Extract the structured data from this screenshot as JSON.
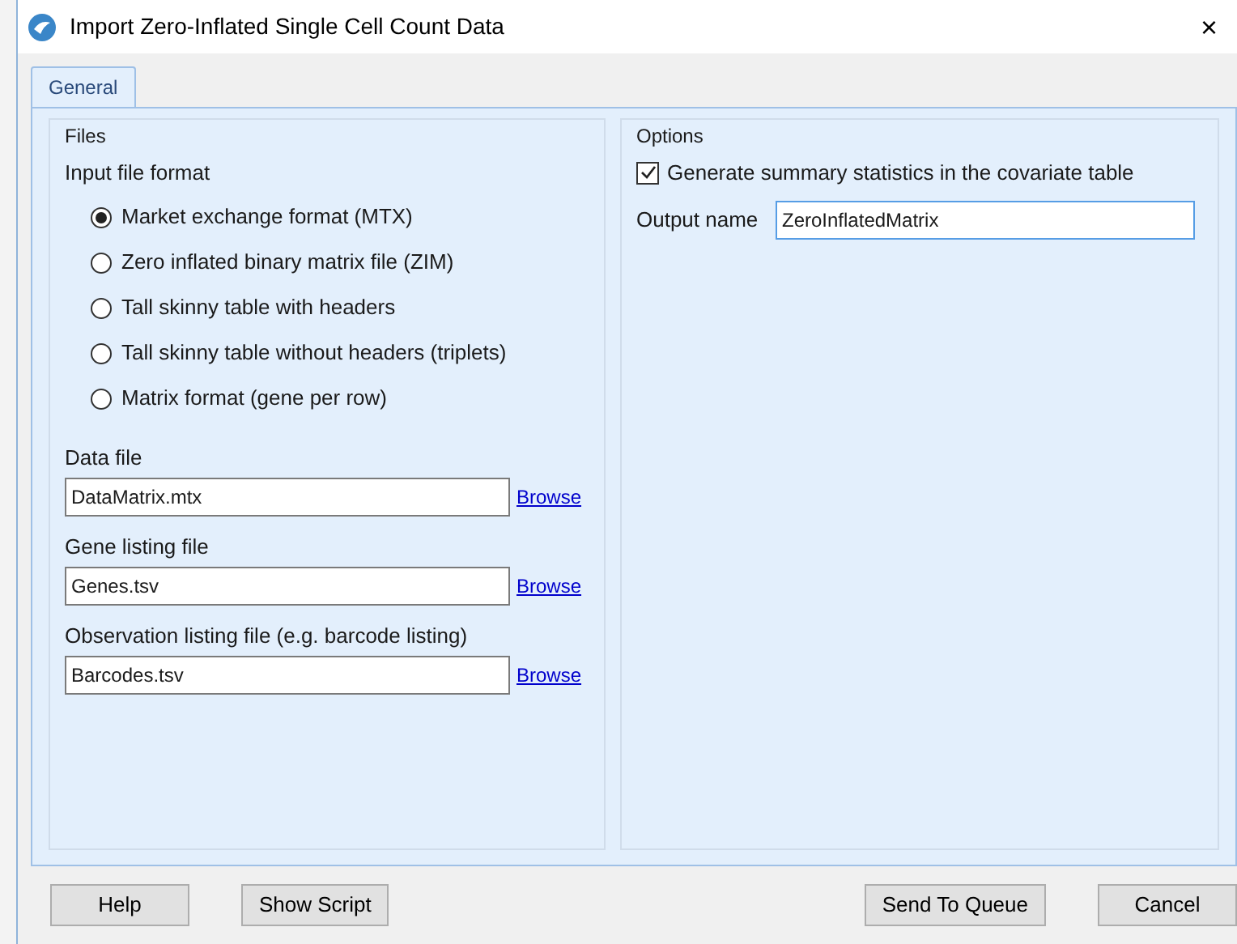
{
  "window": {
    "title": "Import Zero-Inflated Single Cell Count Data",
    "close": "×"
  },
  "tabs": [
    {
      "label": "General",
      "selected": true
    }
  ],
  "files": {
    "title": "Files",
    "format_label": "Input file format",
    "formats": [
      {
        "label": "Market exchange format (MTX)",
        "selected": true
      },
      {
        "label": "Zero inflated binary matrix file (ZIM)",
        "selected": false
      },
      {
        "label": "Tall skinny table with headers",
        "selected": false
      },
      {
        "label": "Tall skinny table without headers (triplets)",
        "selected": false
      },
      {
        "label": "Matrix format (gene per row)",
        "selected": false
      }
    ],
    "inputs": [
      {
        "label": "Data file",
        "value": "DataMatrix.mtx",
        "link": "Browse"
      },
      {
        "label": "Gene listing file",
        "value": "Genes.tsv",
        "link": "Browse"
      },
      {
        "label": "Observation listing file (e.g. barcode listing)",
        "value": "Barcodes.tsv",
        "link": "Browse"
      }
    ]
  },
  "options": {
    "title": "Options",
    "summary": {
      "label": "Generate summary statistics in the covariate table",
      "checked": true
    },
    "output_label": "Output name",
    "output_value": "ZeroInflatedMatrix"
  },
  "buttons_left": [
    "Help",
    "Show Script"
  ],
  "buttons_right": [
    "Send To Queue",
    "Cancel"
  ]
}
